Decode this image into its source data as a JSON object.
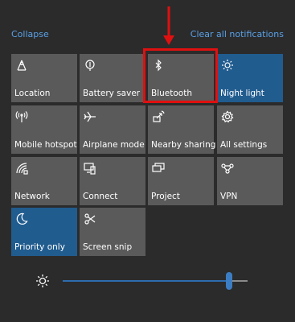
{
  "header": {
    "collapse_label": "Collapse",
    "clear_label": "Clear all notifications"
  },
  "tiles": [
    {
      "label": "Location",
      "icon": "location-icon",
      "active": false
    },
    {
      "label": "Battery saver",
      "icon": "battery-saver-icon",
      "active": false
    },
    {
      "label": "Bluetooth",
      "icon": "bluetooth-icon",
      "active": false
    },
    {
      "label": "Night light",
      "icon": "night-light-icon",
      "active": true
    },
    {
      "label": "Mobile hotspot",
      "icon": "mobile-hotspot-icon",
      "active": false
    },
    {
      "label": "Airplane mode",
      "icon": "airplane-icon",
      "active": false
    },
    {
      "label": "Nearby sharing",
      "icon": "nearby-sharing-icon",
      "active": false
    },
    {
      "label": "All settings",
      "icon": "gear-icon",
      "active": false
    },
    {
      "label": "Network",
      "icon": "network-icon",
      "active": false
    },
    {
      "label": "Connect",
      "icon": "connect-icon",
      "active": false
    },
    {
      "label": "Project",
      "icon": "project-icon",
      "active": false
    },
    {
      "label": "VPN",
      "icon": "vpn-icon",
      "active": false
    },
    {
      "label": "Priority only",
      "icon": "moon-icon",
      "active": true
    },
    {
      "label": "Screen snip",
      "icon": "screen-snip-icon",
      "active": false
    }
  ],
  "brightness": {
    "icon": "brightness-icon",
    "level_fraction": 0.9
  },
  "colors": {
    "tile": "#5a5a5a",
    "tile_active": "#215c8f",
    "link": "#5aa0e6",
    "highlight": "#e01010",
    "background": "#2b2b2b"
  }
}
